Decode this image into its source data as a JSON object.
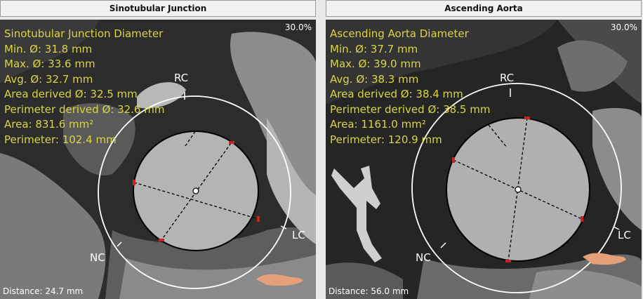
{
  "colors": {
    "measurement_text": "#d8d642",
    "overlay": "#ffffff",
    "marker": "#cc2222"
  },
  "panels": [
    {
      "title": "Sinotubular Junction",
      "zoom": "30.0%",
      "distance": "Distance: 24.7 mm",
      "measurements": [
        "Sinotubular Junction Diameter",
        "Min. Ø: 31.8 mm",
        "Max. Ø: 33.6 mm",
        "Avg. Ø: 32.7 mm",
        "Area derived Ø: 32.5 mm",
        "Perimeter derived Ø: 32.6 mm",
        "Area: 831.6 mm²",
        "Perimeter: 102.4 mm"
      ],
      "labels": {
        "rc": "RC",
        "lc": "LC",
        "nc": "NC"
      }
    },
    {
      "title": "Ascending Aorta",
      "zoom": "30.0%",
      "distance": "Distance: 56.0 mm",
      "measurements": [
        "Ascending Aorta Diameter",
        "Min. Ø: 37.7 mm",
        "Max. Ø: 39.0 mm",
        "Avg. Ø: 38.3 mm",
        "Area derived Ø: 38.4 mm",
        "Perimeter derived Ø: 38.5 mm",
        "Area: 1161.0 mm²",
        "Perimeter: 120.9 mm"
      ],
      "labels": {
        "rc": "RC",
        "lc": "LC",
        "nc": "NC"
      }
    }
  ]
}
